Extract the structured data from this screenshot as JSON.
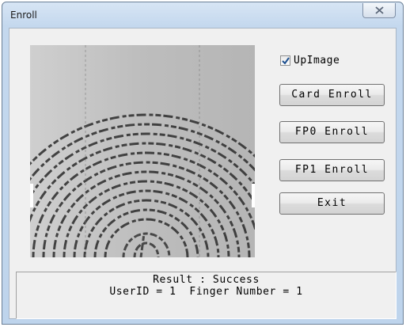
{
  "window": {
    "title": "Enroll"
  },
  "options": {
    "upimage_label": "UpImage",
    "upimage_checked": true
  },
  "buttons": {
    "card_enroll": "Card Enroll",
    "fp0_enroll": "FP0 Enroll",
    "fp1_enroll": "FP1 Enroll",
    "exit": "Exit"
  },
  "result": {
    "line1": "Result : Success",
    "line2": "UserID = 1  Finger Number = 1"
  },
  "icons": {
    "close": "close-icon",
    "check": "checkmark-icon",
    "fingerprint": "fingerprint-image"
  }
}
